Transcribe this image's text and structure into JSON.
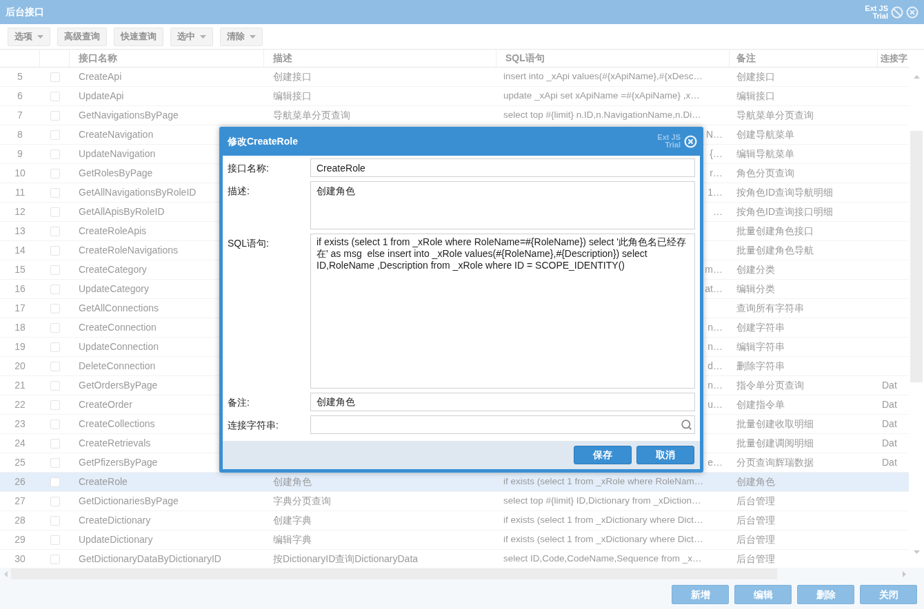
{
  "window": {
    "title": "后台接口",
    "badge": [
      "Ext JS",
      "Trial"
    ]
  },
  "toolbar": [
    {
      "label": "选项",
      "dropdown": true,
      "disabled": true
    },
    {
      "label": "高级查询",
      "dropdown": false,
      "disabled": true
    },
    {
      "label": "快速查询",
      "dropdown": false,
      "disabled": true
    },
    {
      "label": "选中",
      "dropdown": true,
      "disabled": true
    },
    {
      "label": "清除",
      "dropdown": true,
      "disabled": true
    }
  ],
  "table": {
    "columns": [
      "接口名称",
      "描述",
      "SQL语句",
      "备注",
      "连接字"
    ],
    "rows": [
      {
        "num": "5",
        "checked": false,
        "selected": false,
        "name": "CreateApi",
        "desc": "创建接口",
        "sql": "insert into _xApi values(#{xApiName},#{xDesc…",
        "note": "创建接口"
      },
      {
        "num": "6",
        "checked": false,
        "selected": false,
        "name": "UpdateApi",
        "desc": "编辑接口",
        "sql": "update _xApi set xApiName =#{xApiName} ,x…",
        "note": "编辑接口"
      },
      {
        "num": "7",
        "checked": false,
        "selected": false,
        "name": "GetNavigationsByPage",
        "desc": "导航菜单分页查询",
        "sql": "select top #{limit} n.ID,n.NavigationName,n.Di…",
        "note": "导航菜单分页查询"
      },
      {
        "num": "8",
        "checked": false,
        "selected": false,
        "name": "CreateNavigation",
        "sql_tail": "N…",
        "note": "创建导航菜单"
      },
      {
        "num": "9",
        "checked": false,
        "selected": false,
        "name": "UpdateNavigation",
        "sql_tail": "{…",
        "note": "编辑导航菜单"
      },
      {
        "num": "10",
        "checked": false,
        "selected": false,
        "name": "GetRolesByPage",
        "sql_tail": "r…",
        "note": "角色分页查询"
      },
      {
        "num": "11",
        "checked": false,
        "selected": false,
        "name": "GetAllNavigationsByRoleID",
        "sql_tail": "1…",
        "note": "按角色ID查询导航明细"
      },
      {
        "num": "12",
        "checked": false,
        "selected": false,
        "name": "GetAllApisByRoleID",
        "sql_tail": "…",
        "note": "按角色ID查询接口明细"
      },
      {
        "num": "13",
        "checked": false,
        "selected": false,
        "name": "CreateRoleApis",
        "note": "批量创建角色接口"
      },
      {
        "num": "14",
        "checked": false,
        "selected": false,
        "name": "CreateRoleNavigations",
        "note": "批量创建角色导航"
      },
      {
        "num": "15",
        "checked": false,
        "selected": false,
        "name": "CreateCategory",
        "sql_tail": "m…",
        "note": "创建分类"
      },
      {
        "num": "16",
        "checked": false,
        "selected": false,
        "name": "UpdateCategory",
        "sql_tail": "at…",
        "note": "编辑分类"
      },
      {
        "num": "17",
        "checked": false,
        "selected": false,
        "name": "GetAllConnections",
        "note": "查询所有字符串"
      },
      {
        "num": "18",
        "checked": false,
        "selected": false,
        "name": "CreateConnection",
        "sql_tail": "n…",
        "note": "创建字符串"
      },
      {
        "num": "19",
        "checked": false,
        "selected": false,
        "name": "UpdateConnection",
        "sql_tail": "n…",
        "note": "编辑字符串"
      },
      {
        "num": "20",
        "checked": false,
        "selected": false,
        "name": "DeleteConnection",
        "sql_tail": "d…",
        "note": "删除字符串"
      },
      {
        "num": "21",
        "checked": false,
        "selected": false,
        "name": "GetOrdersByPage",
        "sql_tail": "n…",
        "note": "指令单分页查询",
        "conn": "Dat"
      },
      {
        "num": "22",
        "checked": false,
        "selected": false,
        "name": "CreateOrder",
        "sql_tail": "u…",
        "note": "创建指令单",
        "conn": "Dat"
      },
      {
        "num": "23",
        "checked": false,
        "selected": false,
        "name": "CreateCollections",
        "note": "批量创建收取明细",
        "conn": "Dat"
      },
      {
        "num": "24",
        "checked": false,
        "selected": false,
        "name": "CreateRetrievals",
        "note": "批量创建调阅明细",
        "conn": "Dat"
      },
      {
        "num": "25",
        "checked": false,
        "selected": false,
        "name": "GetPfizersByPage",
        "sql_tail": "e…",
        "note": "分页查询辉瑞数据",
        "conn": "Dat"
      },
      {
        "num": "26",
        "checked": false,
        "selected": true,
        "name": "CreateRole",
        "desc": "创建角色",
        "sql": "if exists (select 1 from _xRole where RoleNam…",
        "note": "创建角色"
      },
      {
        "num": "27",
        "checked": false,
        "selected": false,
        "name": "GetDictionariesByPage",
        "desc": "字典分页查询",
        "sql": "select top #{limit} ID,Dictionary from _xDiction…",
        "note": "后台管理"
      },
      {
        "num": "28",
        "checked": false,
        "selected": false,
        "name": "CreateDictionary",
        "desc": "创建字典",
        "sql": "if exists (select 1 from _xDictionary where Dict…",
        "note": "后台管理"
      },
      {
        "num": "29",
        "checked": false,
        "selected": false,
        "name": "UpdateDictionary",
        "desc": "编辑字典",
        "sql": "if exists (select 1 from _xDictionary where Dict…",
        "note": "后台管理"
      },
      {
        "num": "30",
        "checked": false,
        "selected": false,
        "name": "GetDictionaryDataByDictionaryID",
        "desc": "按DictionaryID查询DictionaryData",
        "sql": "select ID,Code,CodeName,Sequence from _x…",
        "note": "后台管理"
      }
    ]
  },
  "footer_buttons": [
    {
      "label": "新增",
      "disabled": true
    },
    {
      "label": "编辑",
      "disabled": true
    },
    {
      "label": "删除",
      "disabled": true
    },
    {
      "label": "关闭",
      "disabled": true
    }
  ],
  "dialog": {
    "title": "修改CreateRole",
    "badge": [
      "Ext JS",
      "Trial"
    ],
    "fields": [
      {
        "kind": "text",
        "label": "接口名称:",
        "value": "CreateRole"
      },
      {
        "kind": "textarea",
        "label": "描述:",
        "value": "创建角色"
      },
      {
        "kind": "textarea_large",
        "label": "SQL语句:",
        "value": "if exists (select 1 from _xRole where RoleName=#{RoleName}) select '此角色名已经存在' as msg  else insert into _xRole values(#{RoleName},#{Description}) select ID,RoleName ,Description from _xRole where ID = SCOPE_IDENTITY()"
      },
      {
        "kind": "text",
        "label": "备注:",
        "value": "创建角色"
      },
      {
        "kind": "search",
        "label": "连接字符串:"
      }
    ],
    "buttons": [
      "保存",
      "取消"
    ]
  }
}
